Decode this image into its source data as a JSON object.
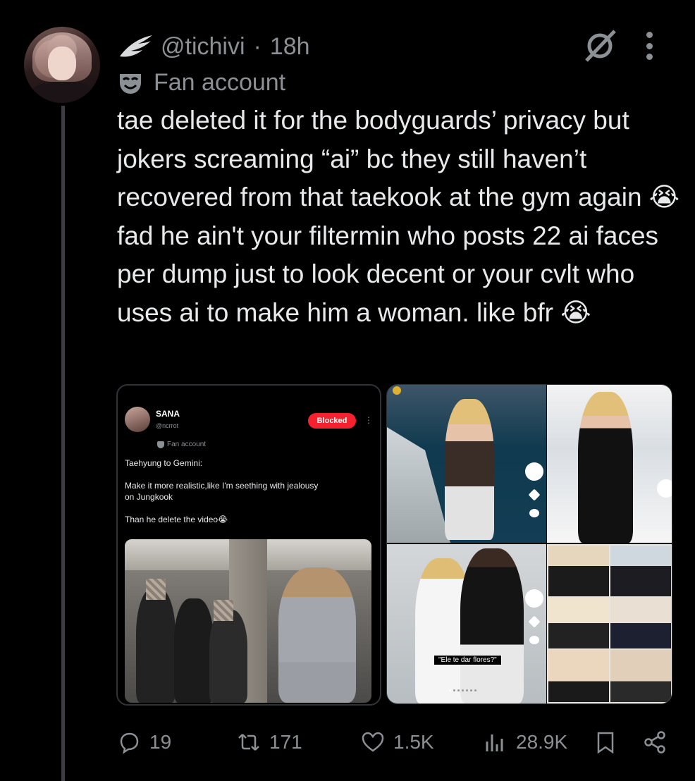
{
  "post": {
    "handle": "@tichivi",
    "separator": "·",
    "time": "18h",
    "label": "Fan account",
    "body": "tae deleted it for the bodyguards’ privacy but jokers screaming “ai” bc they still haven’t recovered from that taekook at the gym again 😭 fad he ain't your filtermin who posts 22 ai faces per dump just to look decent or your cvlt who uses ai to make him a woman. like bfr 😭"
  },
  "quoted_screenshot": {
    "name": "SANA",
    "handle": "@ncrrot",
    "blocked_label": "Blocked",
    "label": "Fan account",
    "text": "Taehyung to Gemini:\n\nMake it more realistic,like I'm seething with jealousy\non Jungkook\n\nThan he delete the video😭"
  },
  "tiktok_collage": {
    "caption": "\"Ele te dar flores?\""
  },
  "actions": {
    "replies": "19",
    "reposts": "171",
    "likes": "1.5K",
    "views": "28.9K"
  },
  "icons": [
    "feather-wing-icon",
    "mask-icon",
    "grok-icon",
    "more-icon",
    "reply-icon",
    "repost-icon",
    "like-icon",
    "views-icon",
    "bookmark-icon",
    "share-icon"
  ],
  "colors": {
    "background": "#000000",
    "text": "#e7e9ea",
    "secondary": "#8b9095",
    "blocked": "#f4212e"
  }
}
